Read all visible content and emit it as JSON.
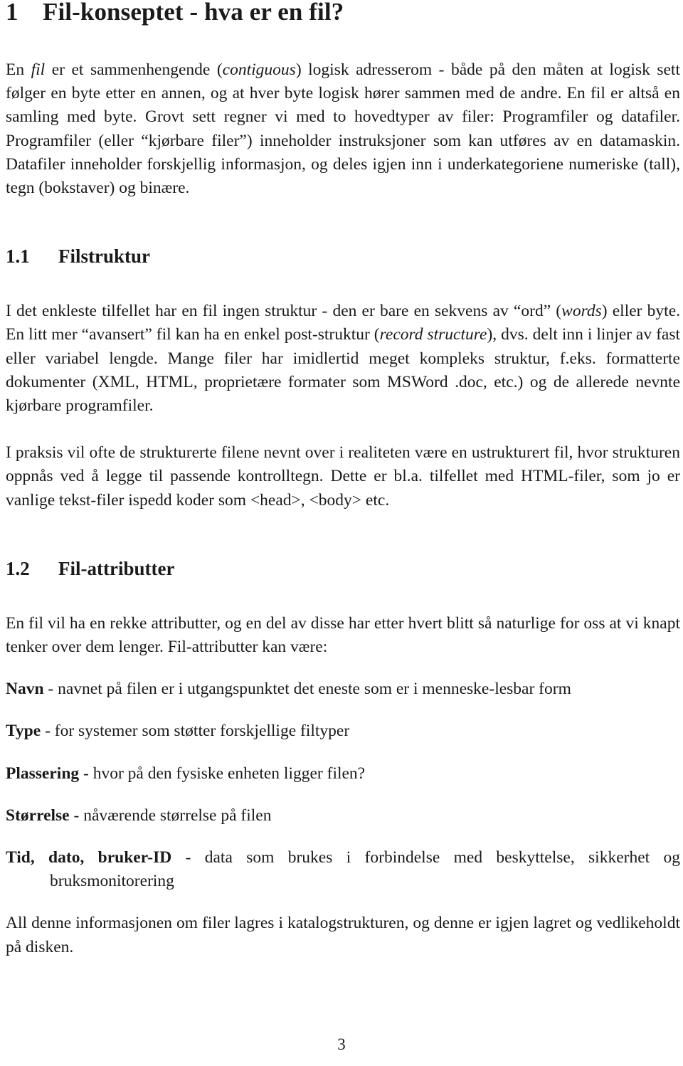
{
  "document": {
    "type": "lecture-notes-page",
    "language": "no",
    "page_number": "3",
    "section": {
      "number": "1",
      "title": "Fil-konseptet - hva er en fil?"
    },
    "intro_paragraph": {
      "part1": "En ",
      "italic1": "fil",
      "part2": " er et sammenhengende (",
      "italic2": "contiguous",
      "part3": ") logisk adresserom - både på den måten at logisk sett følger en byte etter en annen, og at hver byte logisk hører sammen med de andre. En fil er altså en samling med byte. Grovt sett regner vi med to hovedtyper av filer: Programfiler og datafiler. Programfiler (eller “kjørbare filer”) inneholder instruksjoner som kan utføres av en datamaskin. Datafiler inneholder forskjellig informasjon, og deles igjen inn i underkategoriene numeriske (tall), tegn (bokstaver) og binære."
    },
    "subsection_1_1": {
      "number": "1.1",
      "title": "Filstruktur",
      "paragraph1": {
        "part1": "I det enkleste tilfellet har en fil ingen struktur - den er bare en sekvens av “ord” (",
        "italic1": "words",
        "part2": ") eller byte. En litt mer “avansert” fil kan ha en enkel post-struktur (",
        "italic2": "record structure",
        "part3": "), dvs. delt inn i linjer av fast eller variabel lengde. Mange filer har imidlertid meget kompleks struktur, f.eks. formatterte dokumenter (XML, HTML, proprietære formater som MSWord .doc, etc.) og de allerede nevnte kjørbare programfiler."
      },
      "paragraph2": "I praksis vil ofte de strukturerte filene nevnt over i realiteten være en ustrukturert fil, hvor strukturen oppnås ved å legge til passende kontrolltegn. Dette er bl.a. tilfellet med HTML-filer, som jo er vanlige tekst-filer ispedd koder som <head>, <body> etc."
    },
    "subsection_1_2": {
      "number": "1.2",
      "title": "Fil-attributter",
      "intro": "En fil vil ha en rekke attributter, og en del av disse har etter hvert blitt så naturlige for oss at vi knapt tenker over dem lenger. Fil-attributter kan være:",
      "attributes": [
        {
          "term": "Navn",
          "separator": " - ",
          "description": "navnet på filen er i utgangspunktet det eneste som er i menneske-lesbar form"
        },
        {
          "term": "Type",
          "separator": " - ",
          "description": "for systemer som støtter forskjellige filtyper"
        },
        {
          "term": "Plassering",
          "separator": " - ",
          "description": "hvor på den fysiske enheten ligger filen?"
        },
        {
          "term": "Størrelse",
          "separator": " - ",
          "description": "nåværende størrelse på filen"
        },
        {
          "term": "Tid, dato, bruker-ID",
          "separator": " - ",
          "description": "data som brukes i forbindelse med beskyttelse, sikkerhet og bruksmonitorering"
        }
      ],
      "closing": "All denne informasjonen om filer lagres i katalogstrukturen, og denne er igjen lagret og vedlikeholdt på disken."
    }
  }
}
